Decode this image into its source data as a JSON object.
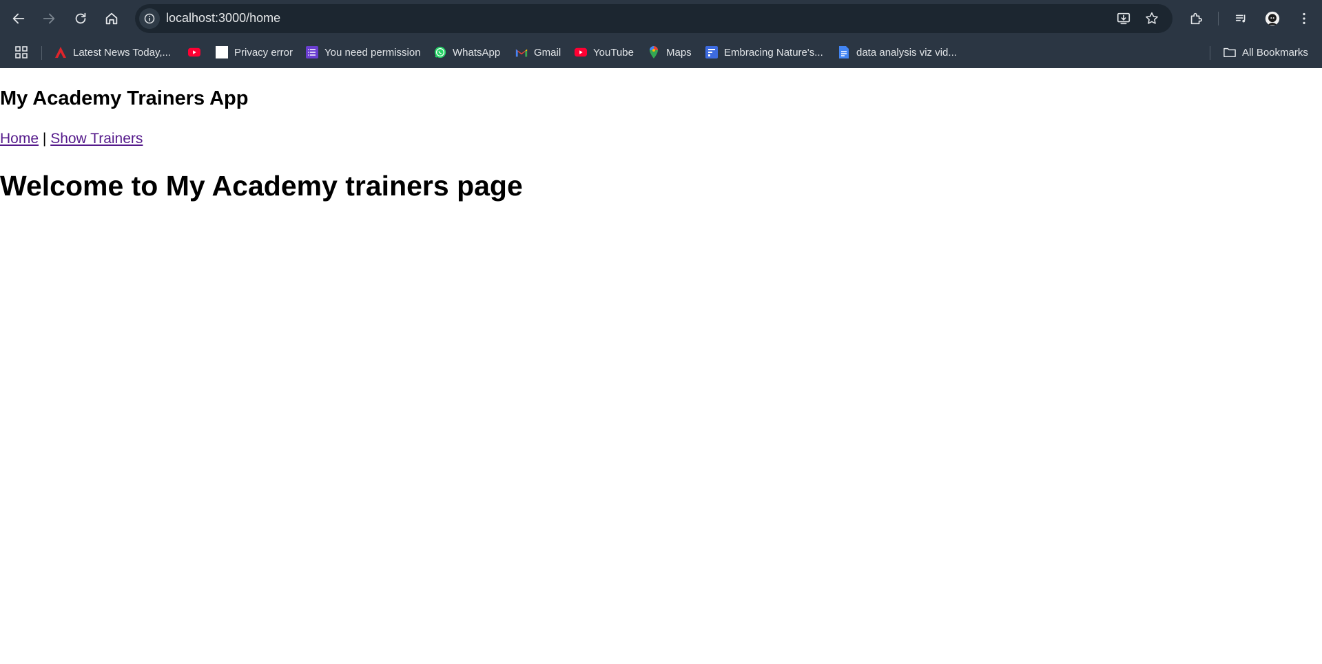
{
  "browser": {
    "url": "localhost:3000/home",
    "bookmarks": [
      {
        "label": "Latest News Today,...",
        "icon": "news-icon"
      },
      {
        "label": "",
        "icon": "youtube-icon"
      },
      {
        "label": "Privacy error",
        "icon": "blank-page-icon"
      },
      {
        "label": "You need permission",
        "icon": "list-icon"
      },
      {
        "label": "WhatsApp",
        "icon": "whatsapp-icon"
      },
      {
        "label": "Gmail",
        "icon": "gmail-icon"
      },
      {
        "label": "YouTube",
        "icon": "youtube-icon"
      },
      {
        "label": "Maps",
        "icon": "maps-icon"
      },
      {
        "label": "Embracing Nature's...",
        "icon": "forms-icon"
      },
      {
        "label": "data analysis viz vid...",
        "icon": "docs-icon"
      }
    ],
    "all_bookmarks": "All Bookmarks",
    "colors": {
      "chrome": "#2b3643",
      "omnibox": "#1c2630"
    }
  },
  "page": {
    "app_title": "My Academy Trainers App",
    "nav": {
      "home": "Home",
      "separator": "|",
      "show_trainers": "Show Trainers"
    },
    "welcome": "Welcome to My Academy trainers page",
    "colors": {
      "visited_link": "#551a8b"
    }
  }
}
